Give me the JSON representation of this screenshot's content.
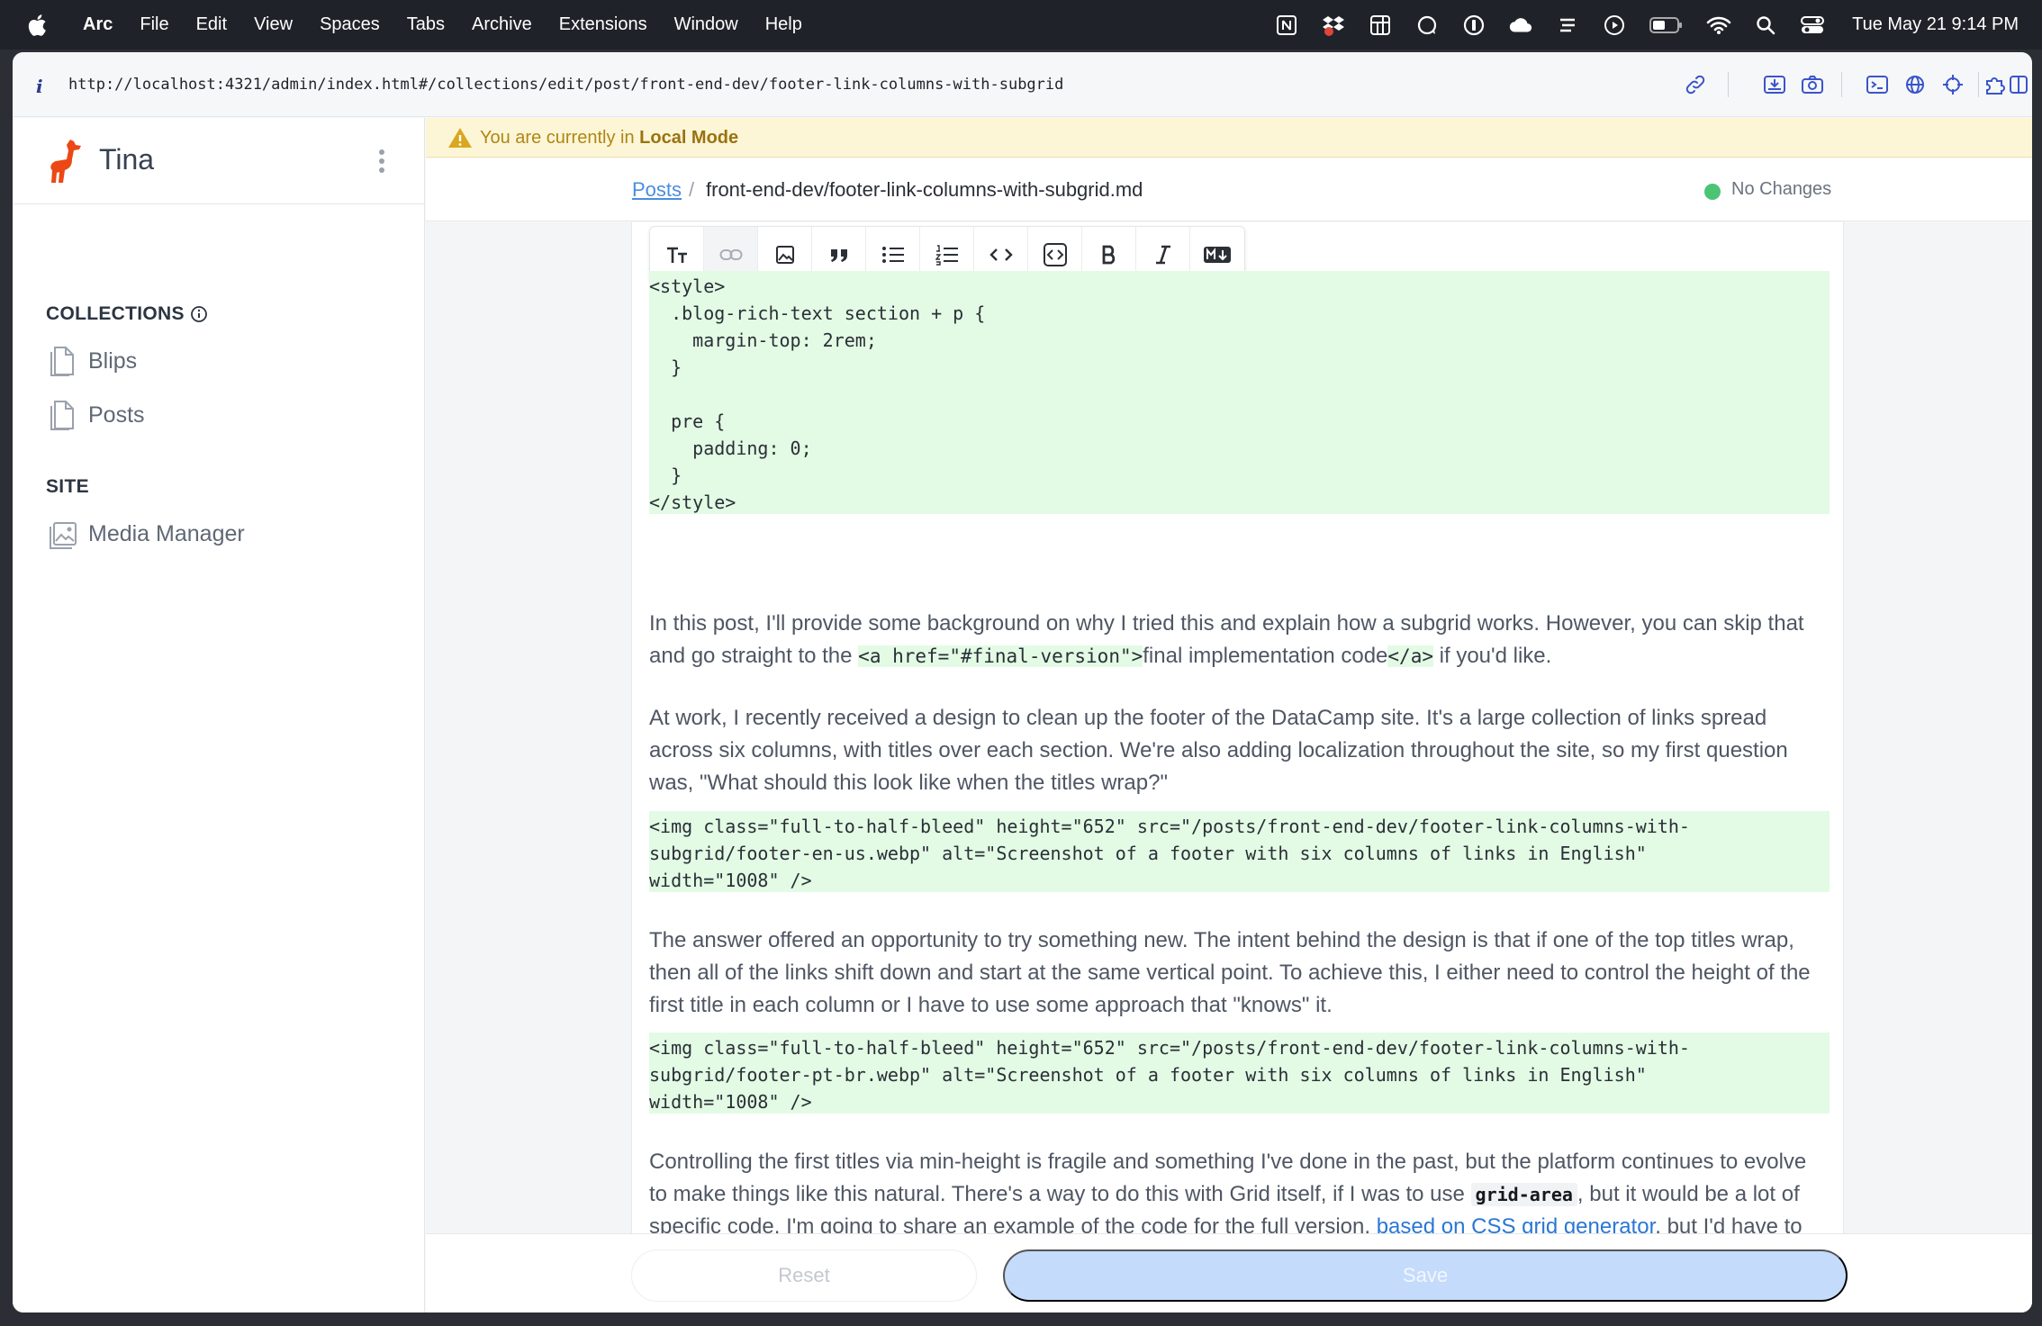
{
  "menubar": {
    "app": "Arc",
    "items": [
      "File",
      "Edit",
      "View",
      "Spaces",
      "Tabs",
      "Archive",
      "Extensions",
      "Window",
      "Help"
    ],
    "clock": "Tue May 21  9:14 PM",
    "status_icons": [
      "notion-icon",
      "dropbox-icon",
      "table-icon",
      "chat-icon",
      "1password-icon",
      "cloud-icon",
      "stripes-icon",
      "play-icon",
      "battery-icon",
      "wifi-icon",
      "spotlight-icon",
      "control-center-icon"
    ]
  },
  "browser": {
    "url": "http://localhost:4321/admin/index.html#/collections/edit/post/front-end-dev/footer-link-columns-with-subgrid",
    "tool_icons": [
      "link-icon",
      "capture-icon",
      "camera-icon",
      "console-icon",
      "globe-icon",
      "crosshair-icon",
      "extensions-icon",
      "split-view-icon"
    ]
  },
  "sidebar": {
    "brand": "Tina",
    "collections_heading": "COLLECTIONS",
    "collections": [
      {
        "label": "Blips",
        "icon": "document-icon"
      },
      {
        "label": "Posts",
        "icon": "document-icon"
      }
    ],
    "site_heading": "SITE",
    "site_items": [
      {
        "label": "Media Manager",
        "icon": "image-icon"
      }
    ]
  },
  "banner": {
    "prefix": "You are currently in ",
    "mode": "Local Mode"
  },
  "breadcrumb": {
    "parent": "Posts",
    "separator": "/",
    "current": "front-end-dev/footer-link-columns-with-subgrid.md",
    "status": "No Changes",
    "status_color": "#4cc475"
  },
  "toolbar": {
    "buttons": [
      "heading-icon",
      "link-icon",
      "image-icon",
      "quote-icon",
      "bullet-list-icon",
      "numbered-list-icon",
      "inline-code-icon",
      "code-block-icon",
      "bold-icon",
      "italic-icon",
      "markdown-icon"
    ]
  },
  "content": {
    "style_block": "<style>\n  .blog-rich-text section + p {\n    margin-top: 2rem;\n  }\n\n  pre {\n    padding: 0;\n  }\n</style>",
    "p1_a": "In this post, I'll provide some background on why I tried this and explain how a subgrid works. However, you can skip that and go straight to the ",
    "p1_html_open": "<a href=\"#final-version\">",
    "p1_b": "final implementation code",
    "p1_html_close": "</a>",
    "p1_c": " if you'd like.",
    "p2": "At work, I recently received a design to clean up the footer of the DataCamp site. It's a large collection of links spread across six columns, with titles over each section. We're also adding localization throughout the site, so my first question was, \"What should this look like when the titles wrap?\"",
    "img1": "<img class=\"full-to-half-bleed\" height=\"652\" src=\"/posts/front-end-dev/footer-link-columns-with-\nsubgrid/footer-en-us.webp\" alt=\"Screenshot of a footer with six columns of links in English\"\nwidth=\"1008\" />",
    "p3": "The answer offered an opportunity to try something new. The intent behind the design is that if one of the top titles wrap, then all of the links shift down and start at the same vertical point. To achieve this, I either need to control the height of the first title in each column or I have to use some approach that \"knows\" it.",
    "img2": "<img class=\"full-to-half-bleed\" height=\"652\" src=\"/posts/front-end-dev/footer-link-columns-with-\nsubgrid/footer-pt-br.webp\" alt=\"Screenshot of a footer with six columns of links in English\"\nwidth=\"1008\" />",
    "p4_a": "Controlling the first titles via min-height is fragile and something I've done in the past, but the platform continues to evolve to make things like this natural. There's a way to do this with Grid itself, if I was to use ",
    "p4_code": "grid-area",
    "p4_b": ", but it would be a lot of specific code. I'm going to share an example of the code for the full version, ",
    "p4_link": "based on CSS grid generator",
    "p4_c": ", but I'd have to set these for when there's two, three, four, and then the six columns. Achievable, but verbose."
  },
  "actions": {
    "reset": "Reset",
    "save": "Save"
  }
}
